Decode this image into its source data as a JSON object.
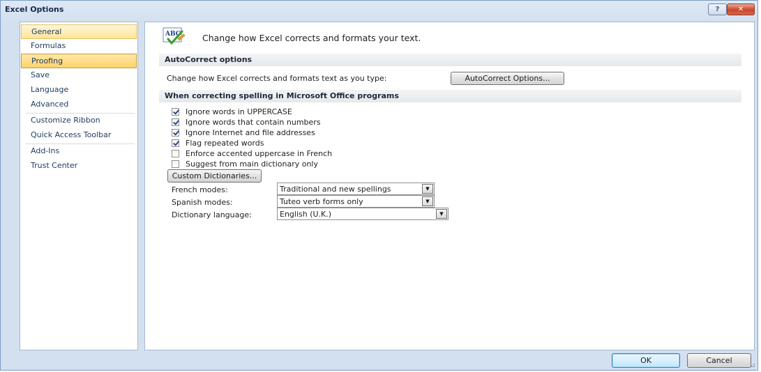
{
  "window": {
    "title": "Excel Options",
    "help_label": "?",
    "close_label": "✕"
  },
  "sidebar": {
    "items": [
      {
        "label": "General"
      },
      {
        "label": "Formulas"
      },
      {
        "label": "Proofing"
      },
      {
        "label": "Save"
      },
      {
        "label": "Language"
      },
      {
        "label": "Advanced"
      },
      {
        "label": "Customize Ribbon"
      },
      {
        "label": "Quick Access Toolbar"
      },
      {
        "label": "Add-Ins"
      },
      {
        "label": "Trust Center"
      }
    ]
  },
  "header": {
    "icon": "abc-check-icon",
    "icon_text": "ABC",
    "text": "Change how Excel corrects and formats your text."
  },
  "autocorrect": {
    "section_title": "AutoCorrect options",
    "description": "Change how Excel corrects and formats text as you type:",
    "button_label": "AutoCorrect Options..."
  },
  "spelling": {
    "section_title": "When correcting spelling in Microsoft Office programs",
    "checkboxes": [
      {
        "label": "Ignore words in UPPERCASE",
        "checked": true
      },
      {
        "label": "Ignore words that contain numbers",
        "checked": true
      },
      {
        "label": "Ignore Internet and file addresses",
        "checked": true
      },
      {
        "label": "Flag repeated words",
        "checked": true
      },
      {
        "label": "Enforce accented uppercase in French",
        "checked": false
      },
      {
        "label": "Suggest from main dictionary only",
        "checked": false
      }
    ],
    "custom_dict_label": "Custom Dictionaries...",
    "french_label": "French modes:",
    "french_value": "Traditional and new spellings",
    "spanish_label": "Spanish modes:",
    "spanish_value": "Tuteo verb forms only",
    "dict_lang_label": "Dictionary language:",
    "dict_lang_value": "English (U.K.)"
  },
  "footer": {
    "ok_label": "OK",
    "cancel_label": "Cancel"
  },
  "colors": {
    "selected_bg": "#ffd26b",
    "hover_bg": "#ffe59a",
    "frame": "#a5b8d0"
  }
}
